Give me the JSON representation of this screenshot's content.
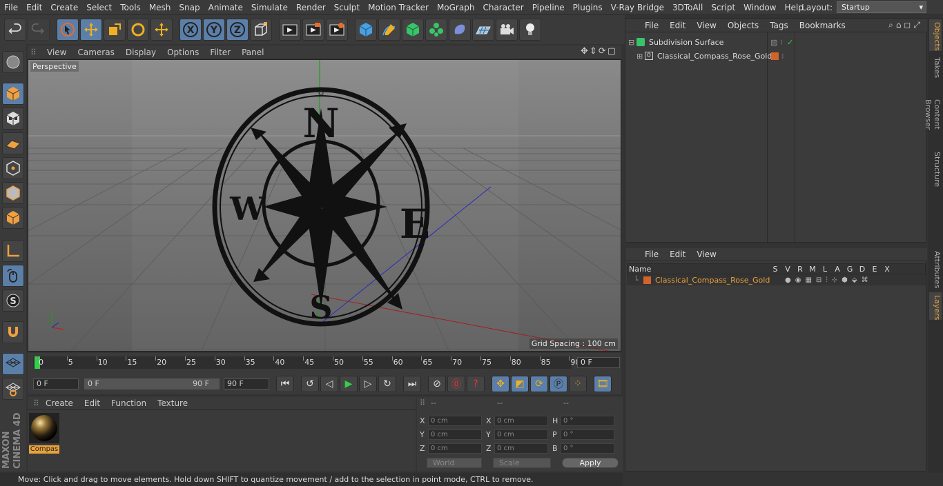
{
  "menu": [
    "File",
    "Edit",
    "Create",
    "Select",
    "Tools",
    "Mesh",
    "Snap",
    "Animate",
    "Simulate",
    "Render",
    "Sculpt",
    "Motion Tracker",
    "MoGraph",
    "Character",
    "Pipeline",
    "Plugins",
    "V-Ray Bridge",
    "3DToAll",
    "Script",
    "Window",
    "Help"
  ],
  "layout": {
    "label": "Layout:",
    "value": "Startup"
  },
  "viewport": {
    "menu": [
      "View",
      "Cameras",
      "Display",
      "Options",
      "Filter",
      "Panel"
    ],
    "label": "Perspective",
    "grid_spacing": "Grid Spacing : 100 cm",
    "compass": {
      "n": "N",
      "s": "S",
      "e": "E",
      "w": "W"
    }
  },
  "timeline": {
    "ticks": [
      "0",
      "5",
      "10",
      "15",
      "20",
      "25",
      "30",
      "35",
      "40",
      "45",
      "50",
      "55",
      "60",
      "65",
      "70",
      "75",
      "80",
      "85",
      "90"
    ],
    "current": "0 F"
  },
  "transport": {
    "start": "0 F",
    "range_start": "0 F",
    "range_end": "90 F",
    "end": "90 F"
  },
  "material_manager": {
    "menu": [
      "Create",
      "Edit",
      "Function",
      "Texture"
    ],
    "material_name": "Compas"
  },
  "coordinates": {
    "header": [
      "--",
      "--",
      "--"
    ],
    "rows": [
      {
        "a": "X",
        "av": "0 cm",
        "b": "X",
        "bv": "0 cm",
        "c": "H",
        "cv": "0 °"
      },
      {
        "a": "Y",
        "av": "0 cm",
        "b": "Y",
        "bv": "0 cm",
        "c": "P",
        "cv": "0 °"
      },
      {
        "a": "Z",
        "av": "0 cm",
        "b": "Z",
        "bv": "0 cm",
        "c": "B",
        "cv": "0 °"
      }
    ],
    "mode": "World",
    "scale": "Scale",
    "apply": "Apply"
  },
  "objects_manager": {
    "menu": [
      "File",
      "Edit",
      "View",
      "Objects",
      "Tags",
      "Bookmarks"
    ],
    "items": [
      {
        "name": "Subdivision Surface"
      },
      {
        "name": "Classical_Compass_Rose_Gold"
      }
    ]
  },
  "layers_manager": {
    "menu": [
      "File",
      "Edit",
      "View"
    ],
    "columns": [
      "Name",
      "S",
      "V",
      "R",
      "M",
      "L",
      "A",
      "G",
      "D",
      "E",
      "X"
    ],
    "layer": "Classical_Compass_Rose_Gold"
  },
  "side_tabs": [
    "Objects",
    "Takes",
    "Content Browser",
    "Structure",
    "Attributes",
    "Layers"
  ],
  "status": "Move: Click and drag to move elements. Hold down SHIFT to quantize movement / add to the selection in point mode, CTRL to remove.",
  "brand": "MAXON CINEMA 4D",
  "colors": {
    "accent_blue": "#5b7fa8",
    "orange": "#e8a23c",
    "layer_orange": "#d2632a"
  }
}
